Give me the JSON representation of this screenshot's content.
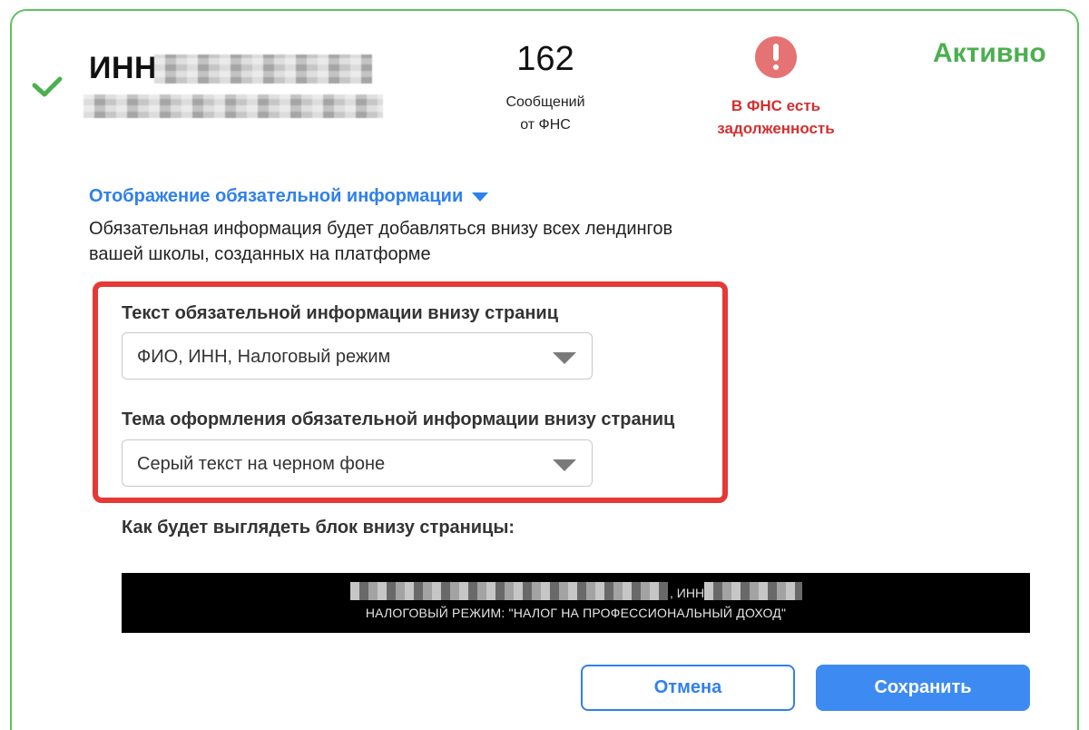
{
  "header": {
    "inn_label": "ИНН",
    "messages_count": "162",
    "messages_label_line1": "Сообщений",
    "messages_label_line2": "от ФНС",
    "alert_line1": "В ФНС есть",
    "alert_line2": "задолженность",
    "status": "Активно"
  },
  "section": {
    "link_label": "Отображение обязательной информации",
    "description_line1": "Обязательная информация будет добавляться внизу всех лендингов",
    "description_line2": "вашей школы, созданных на платформе"
  },
  "fields": {
    "text_label": "Текст обязательной информации внизу страниц",
    "text_value": "ФИО, ИНН, Налоговый режим",
    "theme_label": "Тема оформления обязательной информации внизу страниц",
    "theme_value": "Серый текст на черном фоне"
  },
  "preview": {
    "label": "Как будет выглядеть блок внизу страницы:",
    "inn_part": ", ИНН",
    "regime_line": "НАЛОГОВЫЙ РЕЖИМ: \"НАЛОГ НА ПРОФЕССИОНАЛЬНЫЙ ДОХОД\""
  },
  "buttons": {
    "cancel": "Отмена",
    "save": "Сохранить"
  },
  "colors": {
    "card_border": "#5ec35e",
    "accent_blue": "#2f80ed",
    "status_green": "#4caf50",
    "alert_red": "#d32f2f",
    "highlight_red": "#e53935"
  },
  "icons": [
    "check-icon",
    "alert-icon",
    "caret-down-icon",
    "chevron-down-icon"
  ]
}
